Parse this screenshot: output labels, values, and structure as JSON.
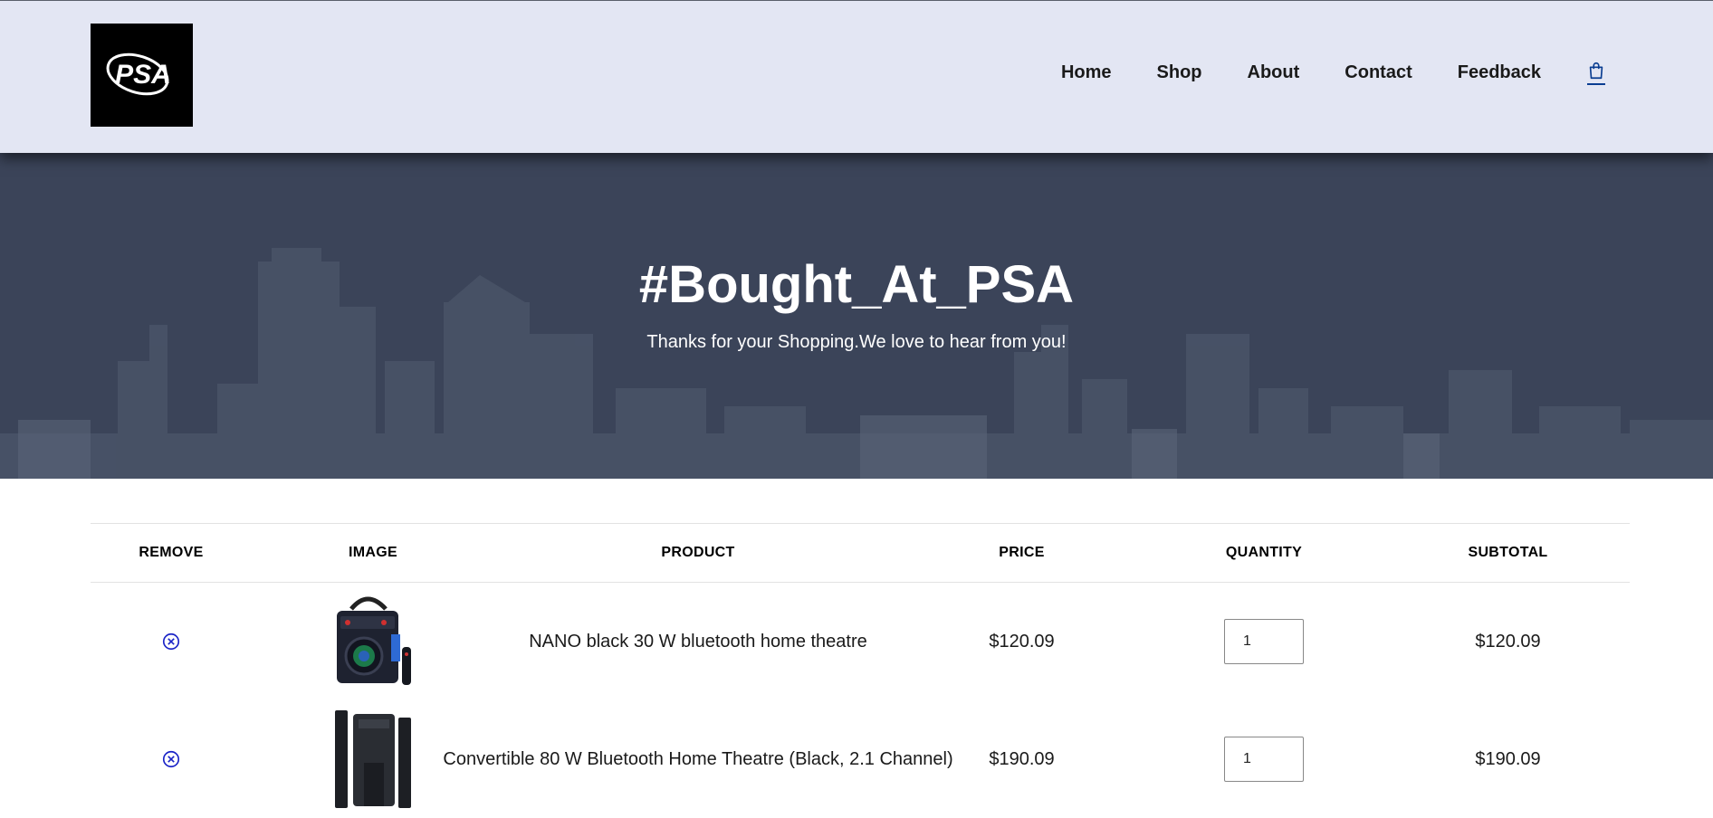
{
  "brand": {
    "logo_text": "PSA"
  },
  "nav": {
    "items": [
      "Home",
      "Shop",
      "About",
      "Contact",
      "Feedback"
    ],
    "cart_icon": "shopping-bag-icon"
  },
  "hero": {
    "title": "#Bought_At_PSA",
    "subtitle": "Thanks for your Shopping.We love to hear from you!"
  },
  "cart": {
    "headers": [
      "REMOVE",
      "IMAGE",
      "PRODUCT",
      "PRICE",
      "QUANTITY",
      "SUBTOTAL"
    ],
    "rows": [
      {
        "product": "NANO black 30 W bluetooth home theatre",
        "price": "$120.09",
        "quantity": "1",
        "subtotal": "$120.09"
      },
      {
        "product": "Convertible 80 W Bluetooth Home Theatre (Black, 2.1 Channel)",
        "price": "$190.09",
        "quantity": "1",
        "subtotal": "$190.09"
      }
    ]
  },
  "colors": {
    "header_bg": "#e3e6f3",
    "hero_bg": "#3b4459",
    "accent": "#0a3d91"
  }
}
